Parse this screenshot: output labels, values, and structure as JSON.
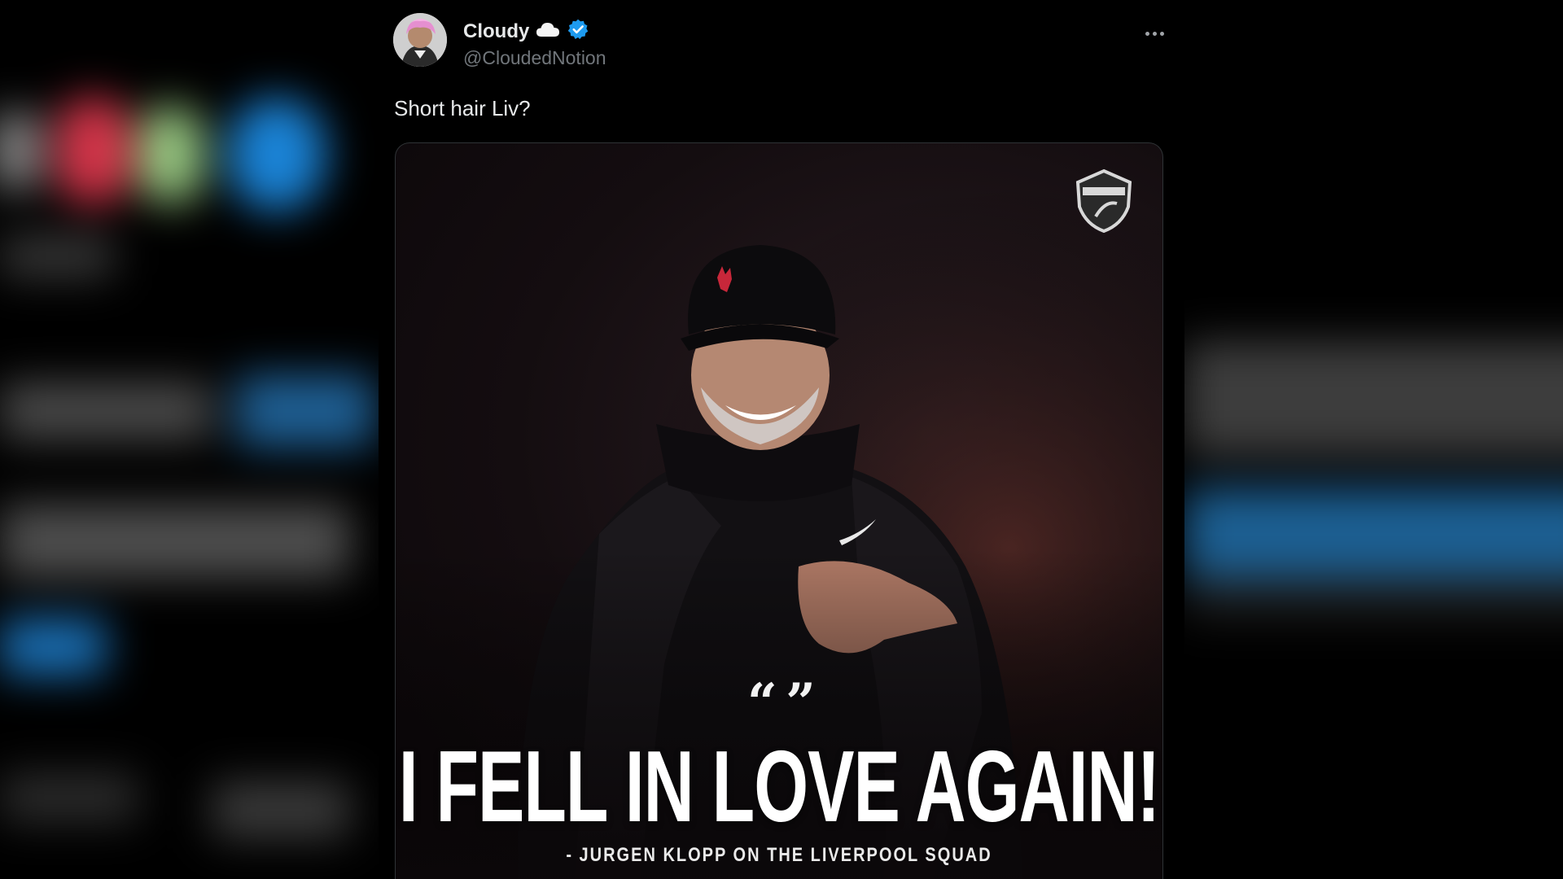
{
  "tweet": {
    "display_name": "Cloudy",
    "handle": "@CloudedNotion",
    "text": "Short hair Liv?",
    "icons": {
      "name_emoji": "cloud-icon",
      "verified": "verified-badge-icon",
      "more": "more-options-icon"
    },
    "media": {
      "quote_glyph": "“ ”",
      "headline": "I FELL IN LOVE AGAIN!",
      "attribution": "- JURGEN KLOPP ON THE LIVERPOOL SQUAD"
    }
  },
  "colors": {
    "background": "#000000",
    "primary_text": "#e7e9ea",
    "secondary_text": "#71767b",
    "verified_blue": "#1d9bf0"
  }
}
